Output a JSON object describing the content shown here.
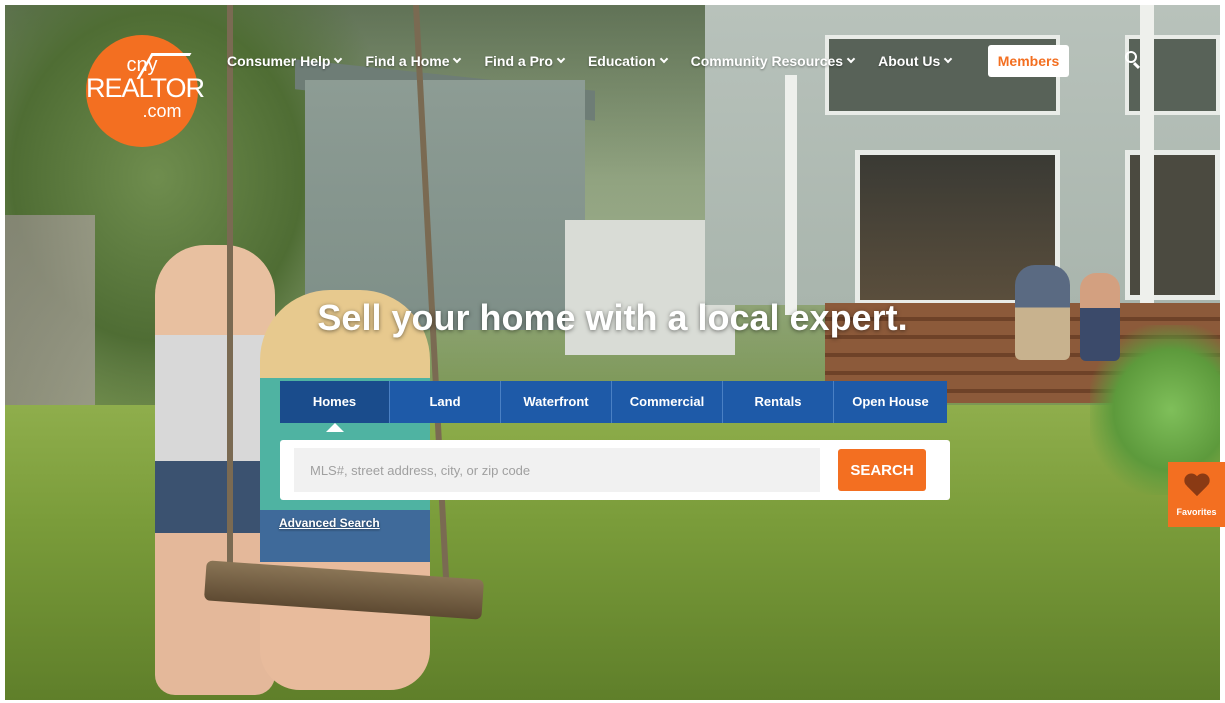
{
  "logo": {
    "line1": "cny",
    "line2": "REALTOR",
    "line3": ".com"
  },
  "nav": {
    "items": [
      {
        "label": "Consumer Help"
      },
      {
        "label": "Find a Home"
      },
      {
        "label": "Find a Pro"
      },
      {
        "label": "Education"
      },
      {
        "label": "Community Resources"
      },
      {
        "label": "About Us"
      }
    ],
    "members_label": "Members",
    "search_icon": "search-icon"
  },
  "hero": {
    "headline": "Sell your home with a local expert."
  },
  "search": {
    "tabs": [
      {
        "label": "Homes",
        "active": true
      },
      {
        "label": "Land"
      },
      {
        "label": "Waterfront"
      },
      {
        "label": "Commercial"
      },
      {
        "label": "Rentals"
      },
      {
        "label": "Open House"
      }
    ],
    "placeholder": "MLS#, street address, city, or zip code",
    "button_label": "SEARCH",
    "advanced_label": "Advanced Search"
  },
  "favorites": {
    "label": "Favorites",
    "icon": "heart-icon"
  },
  "colors": {
    "brand_orange": "#f36f21",
    "tab_blue": "#1e5aa8",
    "tab_active": "#1a4c8c"
  }
}
